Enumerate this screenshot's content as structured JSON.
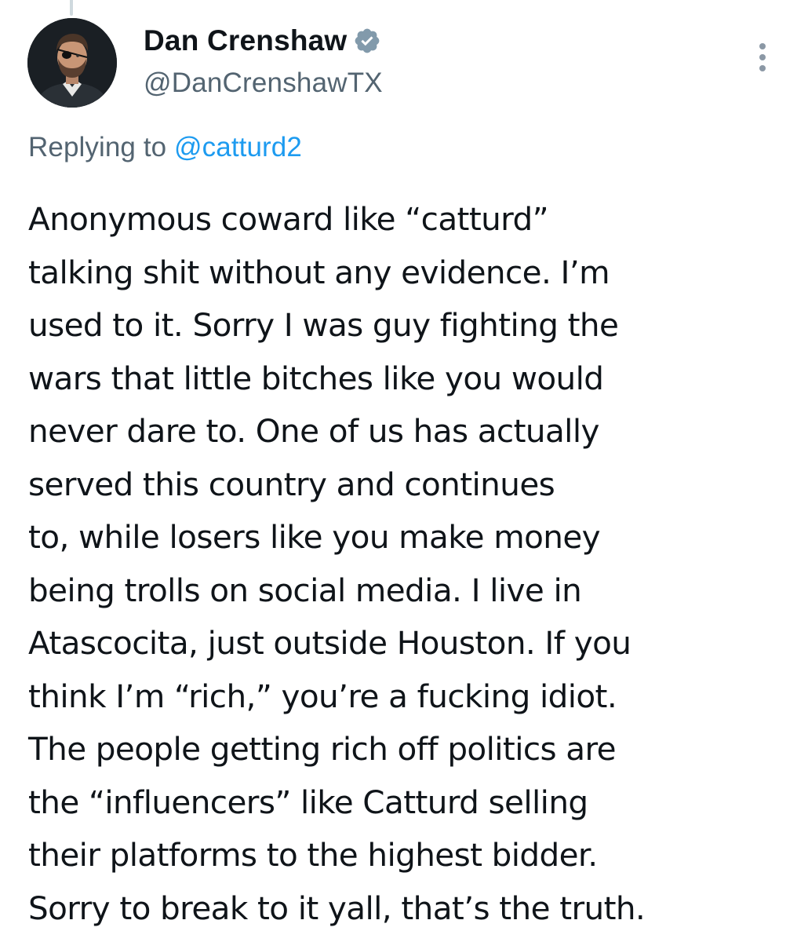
{
  "author": {
    "display_name": "Dan Crenshaw",
    "handle": "@DanCrenshawTX",
    "verified": true
  },
  "icons": {
    "verified": "verified-badge-icon",
    "more": "more-vertical-icon",
    "avatar": "profile-photo"
  },
  "colors": {
    "text": "#0f1419",
    "secondary_text": "#536471",
    "link": "#1d9bf0",
    "verified_badge": "#829aab"
  },
  "reply": {
    "prefix": "Replying to",
    "to_handle": "@catturd2"
  },
  "tweet": {
    "lines": [
      "Anonymous coward like “catturd”",
      "talking shit without any evidence. I’m",
      "used to it. Sorry I was guy fighting the",
      "wars that little bitches like you would",
      "never dare to. One of us has actually",
      "served this country and continues",
      "to, while losers like you make money",
      "being trolls on social media. I live in",
      "Atascocita, just outside Houston. If you",
      "think I’m “rich,” you’re a fucking idiot.",
      "The people getting rich off politics are",
      "the “influencers” like Catturd selling",
      "their platforms to the highest bidder.",
      "Sorry to break to it yall, that’s the truth."
    ]
  }
}
